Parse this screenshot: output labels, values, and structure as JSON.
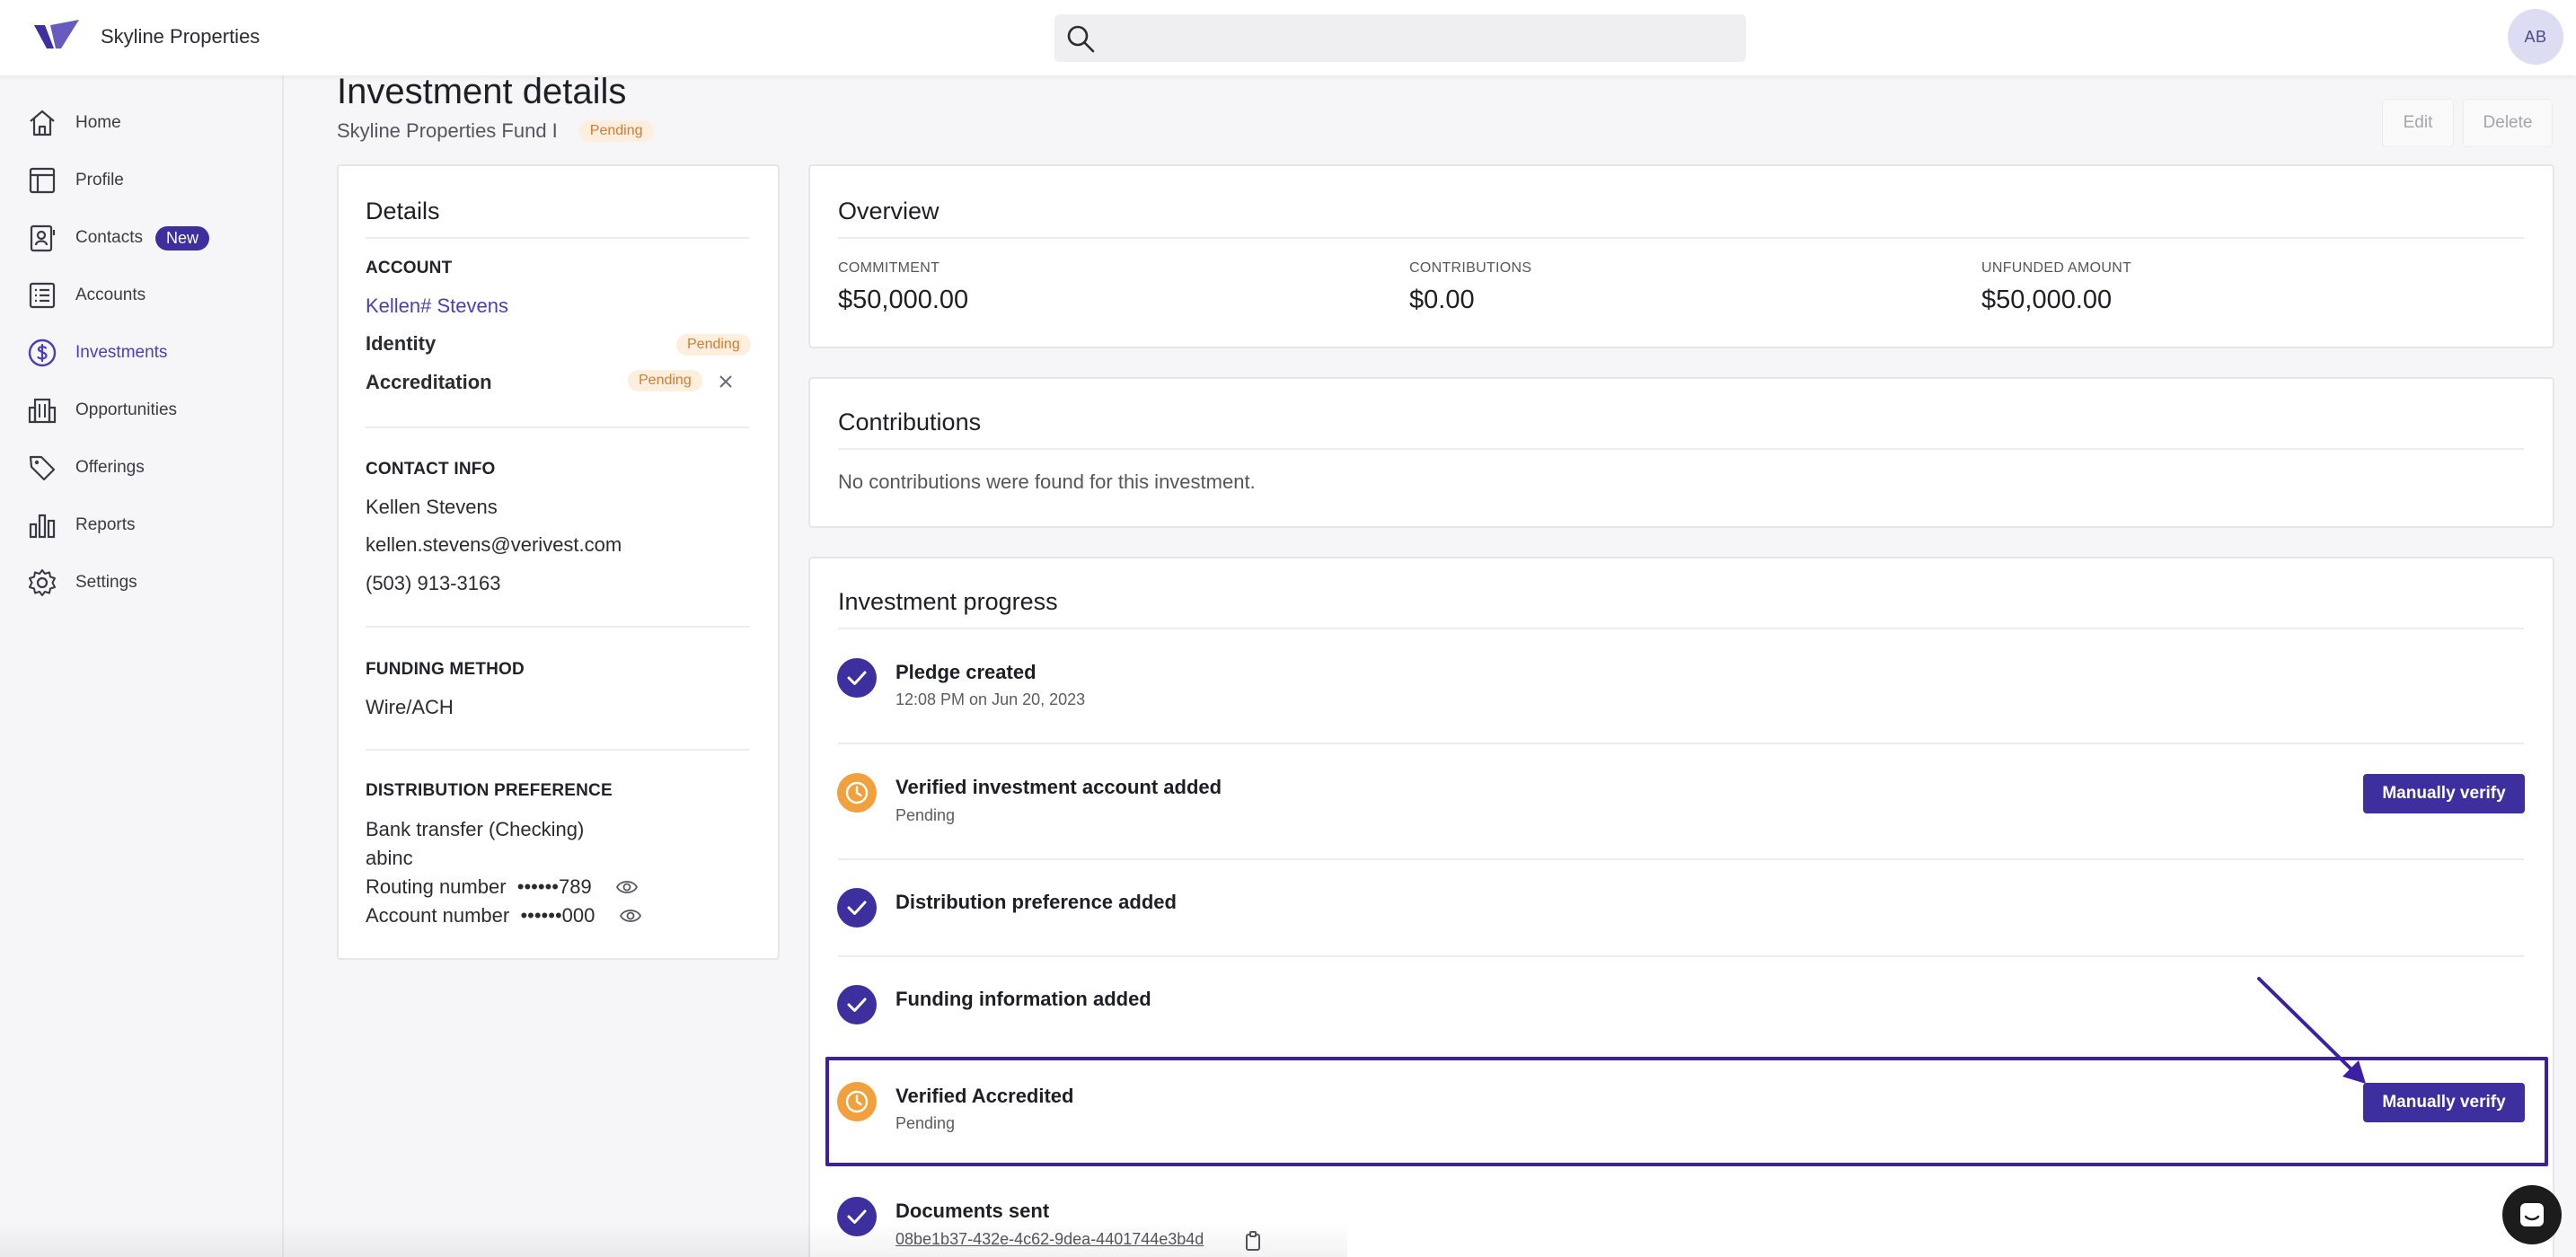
{
  "app": {
    "name": "Skyline Properties",
    "avatar_initials": "AB",
    "brand_color": "#3d2f9e"
  },
  "search": {
    "placeholder": ""
  },
  "sidebar": {
    "items": [
      {
        "label": "Home",
        "icon": "home-icon"
      },
      {
        "label": "Profile",
        "icon": "profile-icon"
      },
      {
        "label": "Contacts",
        "icon": "contacts-icon",
        "badge": "New"
      },
      {
        "label": "Accounts",
        "icon": "list-icon"
      },
      {
        "label": "Investments",
        "icon": "dollar-icon",
        "active": true
      },
      {
        "label": "Opportunities",
        "icon": "building-icon"
      },
      {
        "label": "Offerings",
        "icon": "tag-icon"
      },
      {
        "label": "Reports",
        "icon": "bar-chart-icon"
      },
      {
        "label": "Settings",
        "icon": "gear-icon"
      }
    ]
  },
  "header": {
    "title": "Investment details",
    "fund": "Skyline Properties Fund I",
    "status": "Pending",
    "edit_label": "Edit",
    "delete_label": "Delete"
  },
  "details": {
    "title": "Details",
    "account_heading": "ACCOUNT",
    "account_name": "Kellen# Stevens",
    "identity_label": "Identity",
    "identity_status": "Pending",
    "accreditation_label": "Accreditation",
    "accreditation_status": "Pending",
    "contact_heading": "CONTACT INFO",
    "contact_name": "Kellen Stevens",
    "contact_email": "kellen.stevens@verivest.com",
    "contact_phone": "(503) 913-3163",
    "funding_heading": "FUNDING METHOD",
    "funding_method": "Wire/ACH",
    "distribution_heading": "DISTRIBUTION PREFERENCE",
    "distribution_method": "Bank transfer (Checking)",
    "distribution_bank": "abinc",
    "routing_label": "Routing number",
    "routing_value": "••••••789",
    "account_label": "Account number",
    "account_value": "••••••000"
  },
  "overview": {
    "title": "Overview",
    "commitment_label": "COMMITMENT",
    "commitment_value": "$50,000.00",
    "contributions_label": "CONTRIBUTIONS",
    "contributions_value": "$0.00",
    "unfunded_label": "UNFUNDED AMOUNT",
    "unfunded_value": "$50,000.00"
  },
  "contributions": {
    "title": "Contributions",
    "empty_text": "No contributions were found for this investment."
  },
  "progress": {
    "title": "Investment progress",
    "steps": [
      {
        "title": "Pledge created",
        "sub": "12:08 PM on Jun 20, 2023",
        "state": "done"
      },
      {
        "title": "Verified investment account added",
        "sub": "Pending",
        "state": "pending",
        "action": "Manually verify"
      },
      {
        "title": "Distribution preference added",
        "sub": "",
        "state": "done"
      },
      {
        "title": "Funding information added",
        "sub": "",
        "state": "done"
      },
      {
        "title": "Verified Accredited",
        "sub": "Pending",
        "state": "pending",
        "action": "Manually verify"
      },
      {
        "title": "Documents sent",
        "sub": "08be1b37-432e-4c62-9dea-4401744e3b4d",
        "state": "done"
      }
    ]
  },
  "colors": {
    "done": "#3d2f9e",
    "pending": "#f0a13e",
    "highlight": "#3c1fa3"
  }
}
